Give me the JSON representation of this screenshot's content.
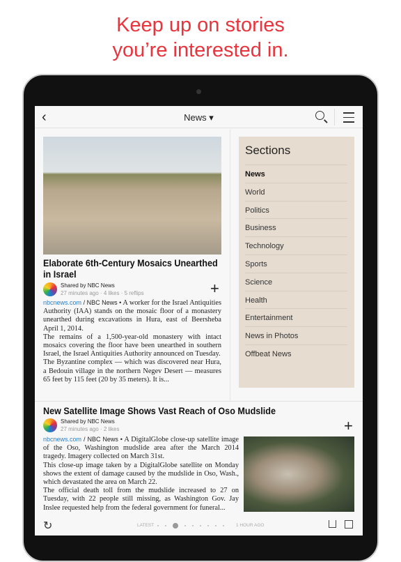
{
  "promo": {
    "line1": "Keep up on stories",
    "line2": "you’re interested in."
  },
  "topbar": {
    "title": "News ▾"
  },
  "articles": [
    {
      "title": "Elaborate 6th-Century Mosaics Unearthed in Israel",
      "shared_by": "Shared by NBC News",
      "stats": "27 minutes ago · 4 likes · 5 reflips",
      "source": "nbcnews.com",
      "publisher": "/ NBC News •",
      "text": [
        " A worker for the Israel Antiquities Authority (IAA) stands on the mosaic floor of a monastery unearthed during excavations in Hura, east of Beersheba April 1, 2014.",
        "The remains of a 1,500-year-old monastery with intact mosaics covering the floor have been unearthed in southern Israel, the Israel Antiquities Authority announced on Tuesday.",
        "The Byzantine complex — which was discovered near Hura, a Bedouin village in the northern Negev Desert — measures 65 feet by 115 feet (20 by 35 meters). It is..."
      ]
    },
    {
      "title": "New Satellite Image Shows Vast Reach of Oso Mudslide",
      "shared_by": "Shared by NBC News",
      "stats": "27 minutes ago · 2 likes",
      "source": "nbcnews.com",
      "publisher": "/ NBC News •",
      "text": [
        " A DigitalGlobe close-up satellite image of the Oso, Washington mudslide area after the March 2014 tragedy. Imagery collected on March 31st.",
        "This close-up image taken by a DigitalGlobe satellite on Monday shows the extent of damage caused by the mudslide in Oso, Wash., which devastated the area on March 22.",
        "The official death toll from the mudslide increased to 27 on Tuesday, with 22 people still missing, as Washington Gov. Jay Inslee requested help from the federal government for funeral..."
      ]
    }
  ],
  "sections": {
    "heading": "Sections",
    "active": "News",
    "items": [
      "News",
      "World",
      "Politics",
      "Business",
      "Technology",
      "Sports",
      "Science",
      "Health",
      "Entertainment",
      "News in Photos",
      "Offbeat News"
    ]
  },
  "bottom": {
    "latest": "LATEST",
    "ago": "1 HOUR AGO",
    "page_index": 2,
    "page_count": 9
  },
  "colors": {
    "accent": "#e8343c",
    "link": "#2a7fc9",
    "sections_bg": "#e7dcd0"
  }
}
